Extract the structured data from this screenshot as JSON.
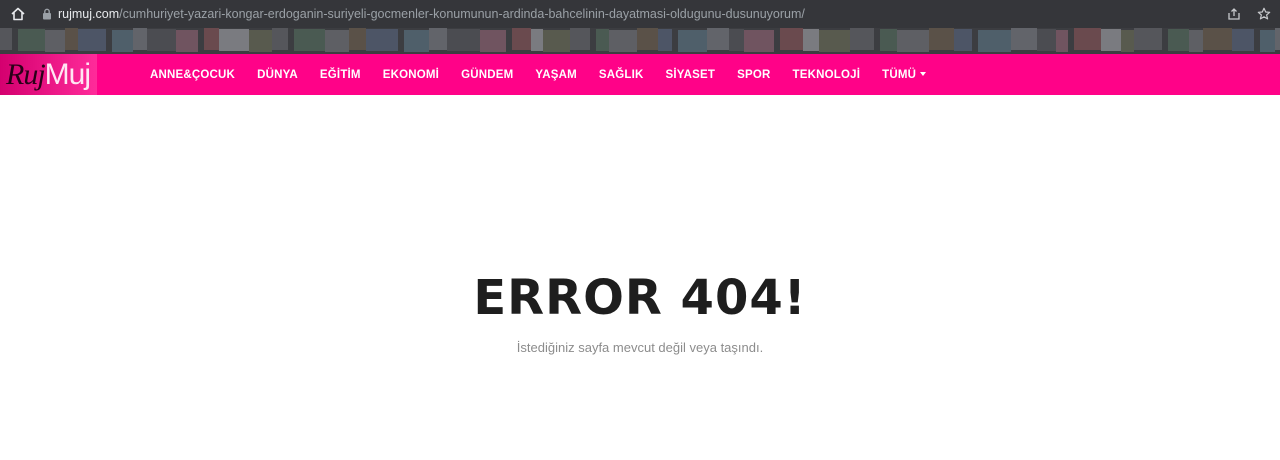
{
  "browser": {
    "url_domain": "rujmuj.com",
    "url_path": "/cumhuriyet-yazari-kongar-erdoganin-suriyeli-gocmenler-konumunun-ardinda-bahcelinin-dayatmasi-oldugunu-dusunuyorum/"
  },
  "site": {
    "logo_part1": "Ruj",
    "logo_part2": "Muj",
    "brand_color": "#ff0288"
  },
  "nav": {
    "items": [
      {
        "label": "ANNE&ÇOCUK"
      },
      {
        "label": "DÜNYA"
      },
      {
        "label": "EĞİTİM"
      },
      {
        "label": "EKONOMİ"
      },
      {
        "label": "GÜNDEM"
      },
      {
        "label": "YAŞAM"
      },
      {
        "label": "SAĞLIK"
      },
      {
        "label": "SİYASET"
      },
      {
        "label": "SPOR"
      },
      {
        "label": "TEKNOLOJİ"
      },
      {
        "label": "TÜMÜ"
      }
    ]
  },
  "error": {
    "title": "ERROR 404!",
    "message": "İstediğiniz sayfa mevcut değil veya taşındı."
  }
}
